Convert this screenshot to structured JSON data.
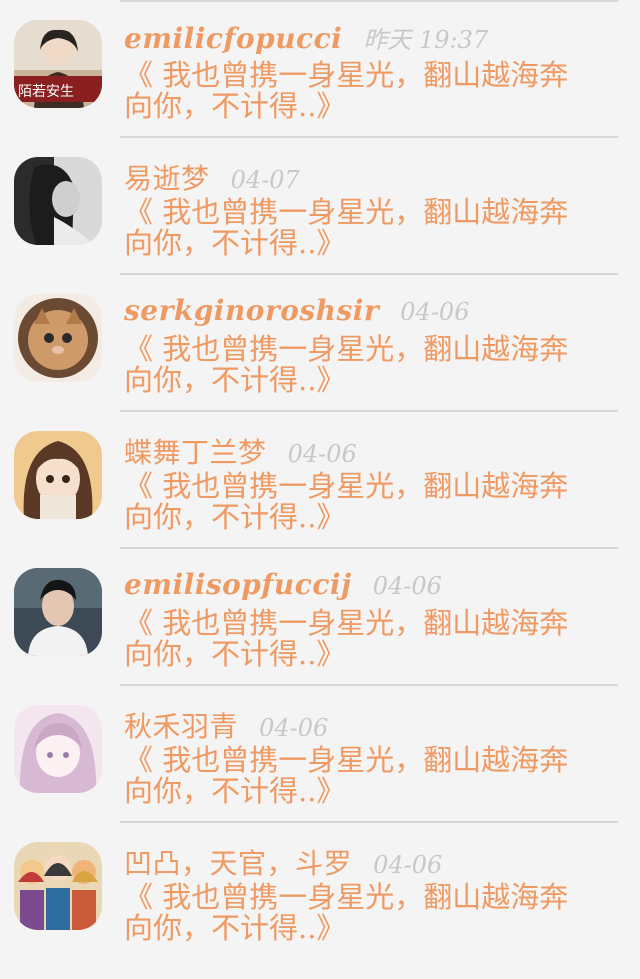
{
  "messages": [
    {
      "name": "emilicfopucci",
      "time": "昨天 19:37",
      "preview": "《 我也曾携一身星光，翻山越海奔向你，不计得..》",
      "avatar": "avatar-girl-sign"
    },
    {
      "name": "易逝梦",
      "time": "04-07",
      "preview": "《 我也曾携一身星光，翻山越海奔向你，不计得..》",
      "avatar": "avatar-bw-girl"
    },
    {
      "name": "serkginoroshsir",
      "time": "04-06",
      "preview": "《 我也曾携一身星光，翻山越海奔向你，不计得..》",
      "avatar": "avatar-cat"
    },
    {
      "name": "蝶舞丁兰梦",
      "time": "04-06",
      "preview": "《 我也曾携一身星光，翻山越海奔向你，不计得..》",
      "avatar": "avatar-anime-girl"
    },
    {
      "name": "emilisopfuccij",
      "time": "04-06",
      "preview": "《 我也曾携一身星光，翻山越海奔向你，不计得..》",
      "avatar": "avatar-boy"
    },
    {
      "name": "秋禾羽青",
      "time": "04-06",
      "preview": "《 我也曾携一身星光，翻山越海奔向你，不计得..》",
      "avatar": "avatar-pink-anime"
    },
    {
      "name": "凹凸，天官，斗罗",
      "time": "04-06",
      "preview": "《 我也曾携一身星光，翻山越海奔向你，不计得..》",
      "avatar": "avatar-group-anime"
    }
  ],
  "avatar_badge_text": "陌若安生",
  "colors": {
    "accent": "#ef9a63",
    "time": "#c8c8c8",
    "divider": "#d6d6d6",
    "background": "#f4f4f4"
  }
}
